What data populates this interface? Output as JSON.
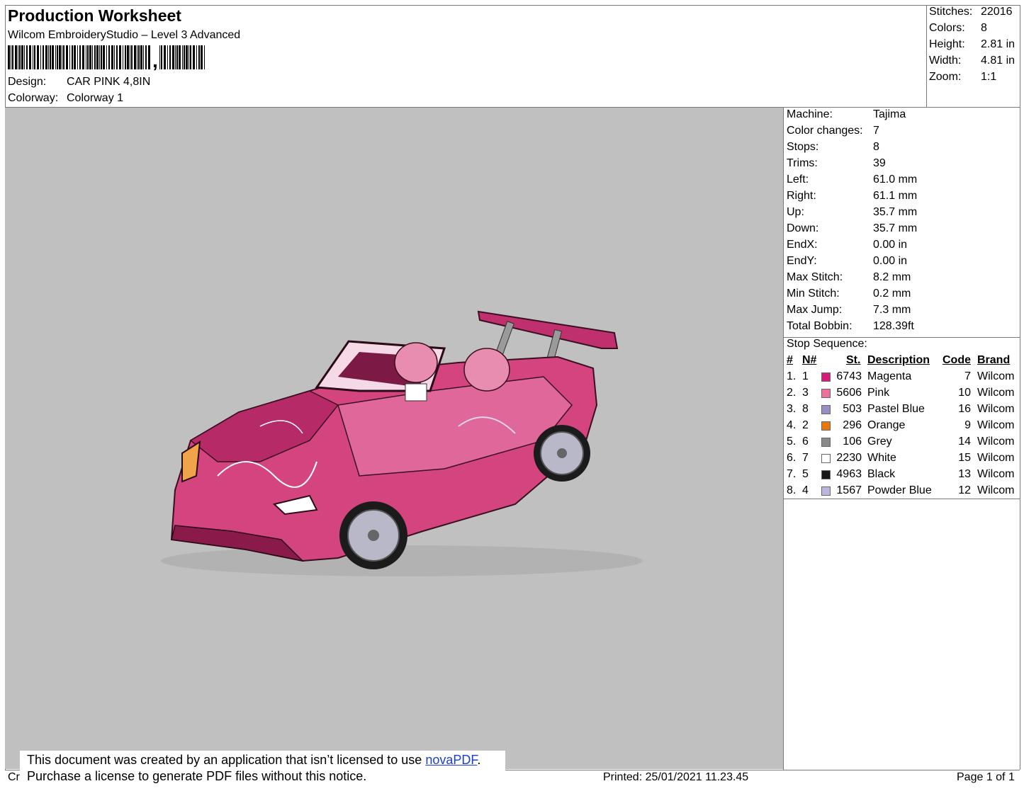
{
  "header": {
    "title": "Production Worksheet",
    "subtitle": "Wilcom EmbroideryStudio – Level 3 Advanced",
    "barcode_suffix": ",",
    "design_label": "Design:",
    "design_value": "CAR PINK 4,8IN",
    "colorway_label": "Colorway:",
    "colorway_value": "Colorway 1"
  },
  "stats": [
    {
      "label": "Stitches:",
      "value": "22016"
    },
    {
      "label": "Colors:",
      "value": "8"
    },
    {
      "label": "Height:",
      "value": "2.81 in"
    },
    {
      "label": "Width:",
      "value": "4.81 in"
    },
    {
      "label": "Zoom:",
      "value": "1:1"
    }
  ],
  "info": [
    {
      "label": "Machine:",
      "value": "Tajima"
    },
    {
      "label": "Color changes:",
      "value": "7"
    },
    {
      "label": "Stops:",
      "value": "8"
    },
    {
      "label": "Trims:",
      "value": "39"
    },
    {
      "label": "Left:",
      "value": "61.0 mm"
    },
    {
      "label": "Right:",
      "value": "61.1 mm"
    },
    {
      "label": "Up:",
      "value": "35.7 mm"
    },
    {
      "label": "Down:",
      "value": "35.7 mm"
    },
    {
      "label": "EndX:",
      "value": "0.00 in"
    },
    {
      "label": "EndY:",
      "value": "0.00 in"
    },
    {
      "label": "Max Stitch:",
      "value": "8.2 mm"
    },
    {
      "label": "Min Stitch:",
      "value": "0.2 mm"
    },
    {
      "label": "Max Jump:",
      "value": "7.3 mm"
    },
    {
      "label": "Total Bobbin:",
      "value": "128.39ft"
    }
  ],
  "stop_sequence": {
    "title": "Stop Sequence:",
    "columns": {
      "num": "#",
      "n": "N#",
      "st": "St.",
      "desc": "Description",
      "code": "Code",
      "brand": "Brand"
    },
    "rows": [
      {
        "num": "1.",
        "n": "1",
        "color": "#d81b7a",
        "st": "6743",
        "desc": "Magenta",
        "code": "7",
        "brand": "Wilcom"
      },
      {
        "num": "2.",
        "n": "3",
        "color": "#f0709a",
        "st": "5606",
        "desc": "Pink",
        "code": "10",
        "brand": "Wilcom"
      },
      {
        "num": "3.",
        "n": "8",
        "color": "#9a8cc4",
        "st": "503",
        "desc": "Pastel Blue",
        "code": "16",
        "brand": "Wilcom"
      },
      {
        "num": "4.",
        "n": "2",
        "color": "#e8780e",
        "st": "296",
        "desc": "Orange",
        "code": "9",
        "brand": "Wilcom"
      },
      {
        "num": "5.",
        "n": "6",
        "color": "#8a8a8a",
        "st": "106",
        "desc": "Grey",
        "code": "14",
        "brand": "Wilcom"
      },
      {
        "num": "6.",
        "n": "7",
        "color": "#ffffff",
        "st": "2230",
        "desc": "White",
        "code": "15",
        "brand": "Wilcom"
      },
      {
        "num": "7.",
        "n": "5",
        "color": "#1a1616",
        "st": "4963",
        "desc": "Black",
        "code": "13",
        "brand": "Wilcom"
      },
      {
        "num": "8.",
        "n": "4",
        "color": "#bdb6dc",
        "st": "1567",
        "desc": "Powder Blue",
        "code": "12",
        "brand": "Wilcom"
      }
    ]
  },
  "footer": {
    "notice_line1_pre": "This document was created by an application that isn’t licensed to use ",
    "notice_link": "novaPDF",
    "notice_line1_post": ".",
    "notice_line2": "Purchase a license to generate PDF files without this notice.",
    "left_fragment": "Cr",
    "printed": "Printed: 25/01/2021 11.23.45",
    "page": "Page 1 of 1"
  },
  "colors": {
    "preview_bg": "#c0c0c0",
    "car_body": "#d4457f",
    "car_dark": "#9c1c5a"
  }
}
